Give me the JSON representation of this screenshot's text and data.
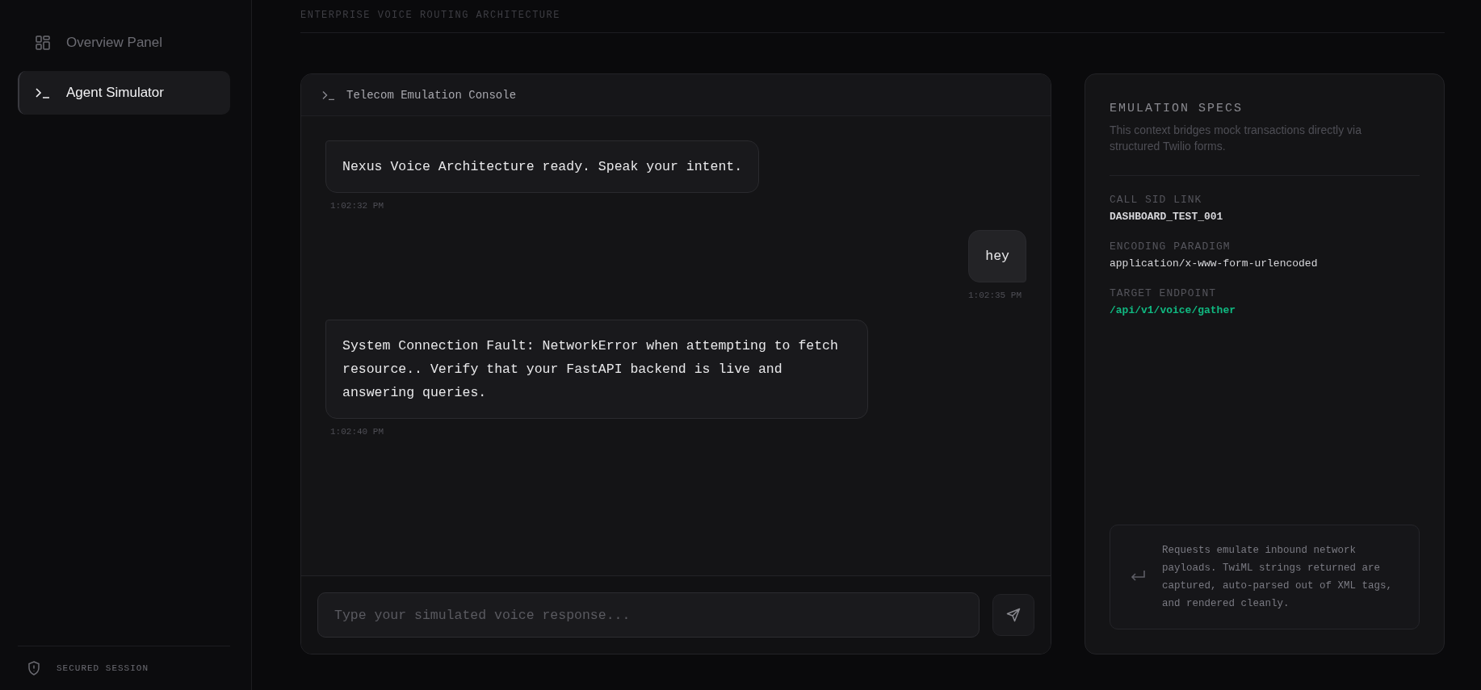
{
  "sidebar": {
    "items": [
      {
        "label": "Overview Panel",
        "selected": false
      },
      {
        "label": "Agent Simulator",
        "selected": true
      }
    ],
    "footer": "SECURED SESSION"
  },
  "header": {
    "subtitle": "ENTERPRISE VOICE ROUTING ARCHITECTURE"
  },
  "console": {
    "title": "Telecom Emulation Console",
    "messages": [
      {
        "kind": "agent",
        "text": "Nexus Voice Architecture ready. Speak your intent.",
        "time": "1:02:32 PM"
      },
      {
        "kind": "user",
        "text": "hey",
        "time": "1:02:35 PM"
      },
      {
        "kind": "agent",
        "text": "System Connection Fault: NetworkError when attempting to fetch resource.. Verify that your FastAPI backend is live and answering queries.",
        "time": "1:02:40 PM"
      }
    ],
    "input": {
      "placeholder": "Type your simulated voice response..."
    }
  },
  "specs": {
    "title": "EMULATION SPECS",
    "description": "This context bridges mock transactions directly via structured Twilio forms.",
    "fields": [
      {
        "label": "CALL SID LINK",
        "value": "DASHBOARD_TEST_001",
        "kind": "id"
      },
      {
        "label": "ENCODING PARADIGM",
        "value": "application/x-www-form-urlencoded",
        "kind": "plain"
      },
      {
        "label": "TARGET ENDPOINT",
        "value": "/api/v1/voice/gather",
        "kind": "endpoint"
      }
    ],
    "note": "Requests emulate inbound network payloads. TwiML strings returned are captured, auto-parsed out of XML tags, and rendered cleanly."
  }
}
